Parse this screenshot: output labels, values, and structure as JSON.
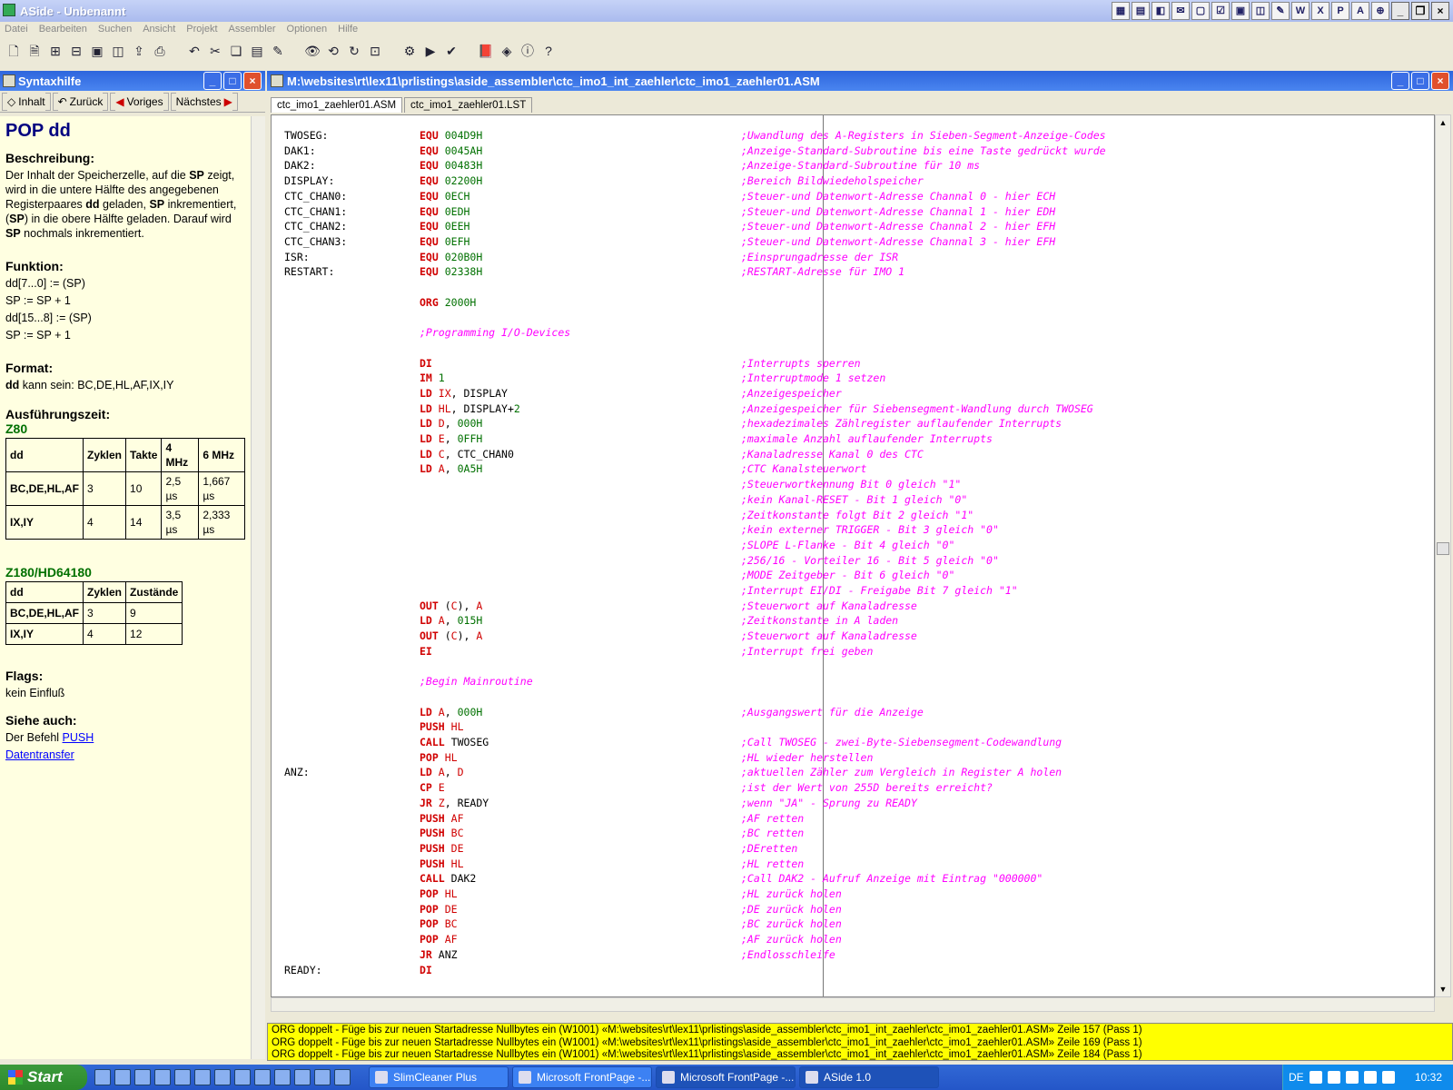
{
  "window": {
    "title": "ASide - Unbenannt"
  },
  "menu": [
    "Datei",
    "Bearbeiten",
    "Suchen",
    "Ansicht",
    "Projekt",
    "Assembler",
    "Optionen",
    "Hilfe"
  ],
  "helppanel": {
    "title": "Syntaxhilfe",
    "nav": {
      "inhalt": "Inhalt",
      "zurueck": "Zurück",
      "voriges": "Voriges",
      "naechstes": "Nächstes"
    },
    "heading": "POP dd",
    "beschreibung_title": "Beschreibung",
    "beschreibung_parts": [
      "Der Inhalt der Speicherzelle, auf die ",
      "SP",
      " zeigt, wird in die untere Hälfte des angegebenen Registerpaares ",
      "dd",
      " geladen, ",
      "SP",
      " inkrementiert, (",
      "SP",
      ") in die obere Hälfte geladen. Darauf wird ",
      "SP",
      " nochmals inkrementiert."
    ],
    "funktion_title": "Funktion",
    "funktion_lines": [
      "dd[7...0] := (SP)",
      "SP := SP + 1",
      "dd[15...8] := (SP)",
      "SP := SP + 1"
    ],
    "format_title": "Format",
    "format_bold": "dd",
    "format_text": " kann sein: BC,DE,HL,AF,IX,IY",
    "zeit_title": "Ausführungszeit",
    "z80_label": "Z80",
    "z80_table": [
      [
        "dd",
        "Zyklen",
        "Takte",
        "4 MHz",
        "6 MHz"
      ],
      [
        "BC,DE,HL,AF",
        "3",
        "10",
        "2,5 µs",
        "1,667 µs"
      ],
      [
        "IX,IY",
        "4",
        "14",
        "3,5 µs",
        "2,333 µs"
      ]
    ],
    "z180_label": "Z180/HD64180",
    "z180_table": [
      [
        "dd",
        "Zyklen",
        "Zustände"
      ],
      [
        "BC,DE,HL,AF",
        "3",
        "9"
      ],
      [
        "IX,IY",
        "4",
        "12"
      ]
    ],
    "flags_title": "Flags",
    "flags_text": "kein Einfluß",
    "siehe_title": "Siehe auch",
    "siehe_text": "Der Befehl ",
    "link_push": "PUSH",
    "link_datentransfer": "Datentransfer"
  },
  "editor": {
    "path": "M:\\websites\\rt\\lex11\\prlistings\\aside_assembler\\ctc_imo1_int_zaehler\\ctc_imo1_zaehler01.ASM",
    "tabs": [
      "ctc_imo1_zaehler01.ASM",
      "ctc_imo1_zaehler01.LST"
    ],
    "lines": [
      {
        "l": "TWOSEG:",
        "k": "EQU",
        "a": [
          [
            "n",
            "004D9H"
          ]
        ],
        "c": ";Uwandlung des A-Registers in Sieben-Segment-Anzeige-Codes"
      },
      {
        "l": "DAK1:",
        "k": "EQU",
        "a": [
          [
            "n",
            "0045AH"
          ]
        ],
        "c": ";Anzeige-Standard-Subroutine bis eine Taste gedrückt wurde"
      },
      {
        "l": "DAK2:",
        "k": "EQU",
        "a": [
          [
            "n",
            "00483H"
          ]
        ],
        "c": ";Anzeige-Standard-Subroutine für 10 ms"
      },
      {
        "l": "DISPLAY:",
        "k": "EQU",
        "a": [
          [
            "n",
            "02200H"
          ]
        ],
        "c": ";Bereich Bildwiedeholspeicher"
      },
      {
        "l": "CTC_CHAN0:",
        "k": "EQU",
        "a": [
          [
            "n",
            "0ECH"
          ]
        ],
        "c": ";Steuer-und Datenwort-Adresse Channal 0 - hier ECH"
      },
      {
        "l": "CTC_CHAN1:",
        "k": "EQU",
        "a": [
          [
            "n",
            "0EDH"
          ]
        ],
        "c": ";Steuer-und Datenwort-Adresse Channal 1 - hier EDH"
      },
      {
        "l": "CTC_CHAN2:",
        "k": "EQU",
        "a": [
          [
            "n",
            "0EEH"
          ]
        ],
        "c": ";Steuer-und Datenwort-Adresse Channal 2 - hier EFH"
      },
      {
        "l": "CTC_CHAN3:",
        "k": "EQU",
        "a": [
          [
            "n",
            "0EFH"
          ]
        ],
        "c": ";Steuer-und Datenwort-Adresse Channal 3 - hier EFH"
      },
      {
        "l": "ISR:",
        "k": "EQU",
        "a": [
          [
            "n",
            "020B0H"
          ]
        ],
        "c": ";Einsprungadresse der ISR"
      },
      {
        "l": "RESTART:",
        "k": "EQU",
        "a": [
          [
            "n",
            "02338H"
          ]
        ],
        "c": ";RESTART-Adresse für IMO 1"
      },
      {},
      {
        "k": "ORG",
        "a": [
          [
            "n",
            "2000H"
          ]
        ]
      },
      {},
      {
        "ic": ";Programming I/O-Devices"
      },
      {},
      {
        "k": "DI",
        "c": ";Interrupts sperren"
      },
      {
        "k": "IM",
        "a": [
          [
            "n",
            "1"
          ]
        ],
        "c": ";Interruptmode 1 setzen"
      },
      {
        "k": "LD",
        "a": [
          [
            "r",
            "IX"
          ],
          [
            "o",
            ", DISPLAY"
          ]
        ],
        "c": ";Anzeigespeicher"
      },
      {
        "k": "LD",
        "a": [
          [
            "r",
            "HL"
          ],
          [
            "o",
            ", DISPLAY+"
          ],
          [
            "n",
            "2"
          ]
        ],
        "c": ";Anzeigespeicher für Siebensegment-Wandlung durch TWOSEG"
      },
      {
        "k": "LD",
        "a": [
          [
            "r",
            "D"
          ],
          [
            "o",
            ", "
          ],
          [
            "n",
            "000H"
          ]
        ],
        "c": ";hexadezimales Zählregister auflaufender Interrupts"
      },
      {
        "k": "LD",
        "a": [
          [
            "r",
            "E"
          ],
          [
            "o",
            ", "
          ],
          [
            "n",
            "0FFH"
          ]
        ],
        "c": ";maximale Anzahl auflaufender Interrupts"
      },
      {
        "k": "LD",
        "a": [
          [
            "r",
            "C"
          ],
          [
            "o",
            ", CTC_CHAN0"
          ]
        ],
        "c": ";Kanaladresse Kanal 0 des CTC"
      },
      {
        "k": "LD",
        "a": [
          [
            "r",
            "A"
          ],
          [
            "o",
            ", "
          ],
          [
            "n",
            "0A5H"
          ]
        ],
        "c": ";CTC Kanalsteuerwort"
      },
      {
        "c": ";Steuerwortkennung Bit 0 gleich \"1\""
      },
      {
        "c": ";kein Kanal-RESET - Bit 1 gleich \"0\""
      },
      {
        "c": ";Zeitkonstante folgt Bit 2 gleich \"1\""
      },
      {
        "c": ";kein externer TRIGGER - Bit 3 gleich \"0\""
      },
      {
        "c": ";SLOPE L-Flanke - Bit 4 gleich \"0\""
      },
      {
        "c": ";256/16 - Vorteiler 16 - Bit 5 gleich \"0\""
      },
      {
        "c": ";MODE Zeitgeber - Bit 6 gleich \"0\""
      },
      {
        "c": ";Interrupt EI/DI - Freigabe Bit 7 gleich \"1\""
      },
      {
        "k": "OUT",
        "a": [
          [
            "o",
            "("
          ],
          [
            "r",
            "C"
          ],
          [
            "o",
            "), "
          ],
          [
            "r",
            "A"
          ]
        ],
        "c": ";Steuerwort auf Kanaladresse"
      },
      {
        "k": "LD",
        "a": [
          [
            "r",
            "A"
          ],
          [
            "o",
            ", "
          ],
          [
            "n",
            "015H"
          ]
        ],
        "c": ";Zeitkonstante in A laden"
      },
      {
        "k": "OUT",
        "a": [
          [
            "o",
            "("
          ],
          [
            "r",
            "C"
          ],
          [
            "o",
            "), "
          ],
          [
            "r",
            "A"
          ]
        ],
        "c": ";Steuerwort auf Kanaladresse"
      },
      {
        "k": "EI",
        "c": ";Interrupt frei geben"
      },
      {},
      {
        "ic": ";Begin Mainroutine"
      },
      {},
      {
        "k": "LD",
        "a": [
          [
            "r",
            "A"
          ],
          [
            "o",
            ", "
          ],
          [
            "n",
            "000H"
          ]
        ],
        "c": ";Ausgangswert für die Anzeige"
      },
      {
        "k": "PUSH",
        "a": [
          [
            "r",
            "HL"
          ]
        ]
      },
      {
        "k": "CALL",
        "a": [
          [
            "o",
            "TWOSEG"
          ]
        ],
        "c": ";Call TWOSEG - zwei-Byte-Siebensegment-Codewandlung"
      },
      {
        "k": "POP",
        "a": [
          [
            "r",
            "HL"
          ]
        ],
        "c": ";HL wieder herstellen"
      },
      {
        "l": "ANZ:",
        "k": "LD",
        "a": [
          [
            "r",
            "A"
          ],
          [
            "o",
            ", "
          ],
          [
            "r",
            "D"
          ]
        ],
        "c": ";aktuellen Zähler zum Vergleich in Register A holen"
      },
      {
        "k": "CP",
        "a": [
          [
            "r",
            "E"
          ]
        ],
        "c": ";ist der Wert von 255D bereits erreicht?"
      },
      {
        "k": "JR",
        "a": [
          [
            "r",
            "Z"
          ],
          [
            "o",
            ", READY"
          ]
        ],
        "c": ";wenn \"JA\" - Sprung zu READY"
      },
      {
        "k": "PUSH",
        "a": [
          [
            "r",
            "AF"
          ]
        ],
        "c": ";AF retten"
      },
      {
        "k": "PUSH",
        "a": [
          [
            "r",
            "BC"
          ]
        ],
        "c": ";BC retten"
      },
      {
        "k": "PUSH",
        "a": [
          [
            "r",
            "DE"
          ]
        ],
        "c": ";DEretten"
      },
      {
        "k": "PUSH",
        "a": [
          [
            "r",
            "HL"
          ]
        ],
        "c": ";HL retten"
      },
      {
        "k": "CALL",
        "a": [
          [
            "o",
            "DAK2"
          ]
        ],
        "c": ";Call DAK2 - Aufruf Anzeige mit Eintrag \"000000\""
      },
      {
        "k": "POP",
        "a": [
          [
            "r",
            "HL"
          ]
        ],
        "c": ";HL zurück holen"
      },
      {
        "k": "POP",
        "a": [
          [
            "r",
            "DE"
          ]
        ],
        "c": ";DE zurück holen"
      },
      {
        "k": "POP",
        "a": [
          [
            "r",
            "BC"
          ]
        ],
        "c": ";BC zurück holen"
      },
      {
        "k": "POP",
        "a": [
          [
            "r",
            "AF"
          ]
        ],
        "c": ";AF zurück holen"
      },
      {
        "k": "JR",
        "a": [
          [
            "o",
            "ANZ"
          ]
        ],
        "c": ";Endlosschleife"
      },
      {
        "l": "READY:",
        "k": "DI"
      }
    ]
  },
  "messages": [
    "ORG doppelt - Füge bis zur neuen Startadresse Nullbytes ein (W1001) «M:\\websites\\rt\\lex11\\prlistings\\aside_assembler\\ctc_imo1_int_zaehler\\ctc_imo1_zaehler01.ASM» Zeile 157 (Pass 1)",
    "ORG doppelt - Füge bis zur neuen Startadresse Nullbytes ein (W1001) «M:\\websites\\rt\\lex11\\prlistings\\aside_assembler\\ctc_imo1_int_zaehler\\ctc_imo1_zaehler01.ASM» Zeile 169 (Pass 1)",
    "ORG doppelt - Füge bis zur neuen Startadresse Nullbytes ein (W1001) «M:\\websites\\rt\\lex11\\prlistings\\aside_assembler\\ctc_imo1_int_zaehler\\ctc_imo1_zaehler01.ASM» Zeile 184 (Pass 1)"
  ],
  "taskbar": {
    "start": "Start",
    "tasks": [
      "SlimCleaner Plus",
      "Microsoft FrontPage -...",
      "Microsoft FrontPage -...",
      "ASide 1.0"
    ],
    "lang": "DE",
    "clock": "10:32"
  }
}
